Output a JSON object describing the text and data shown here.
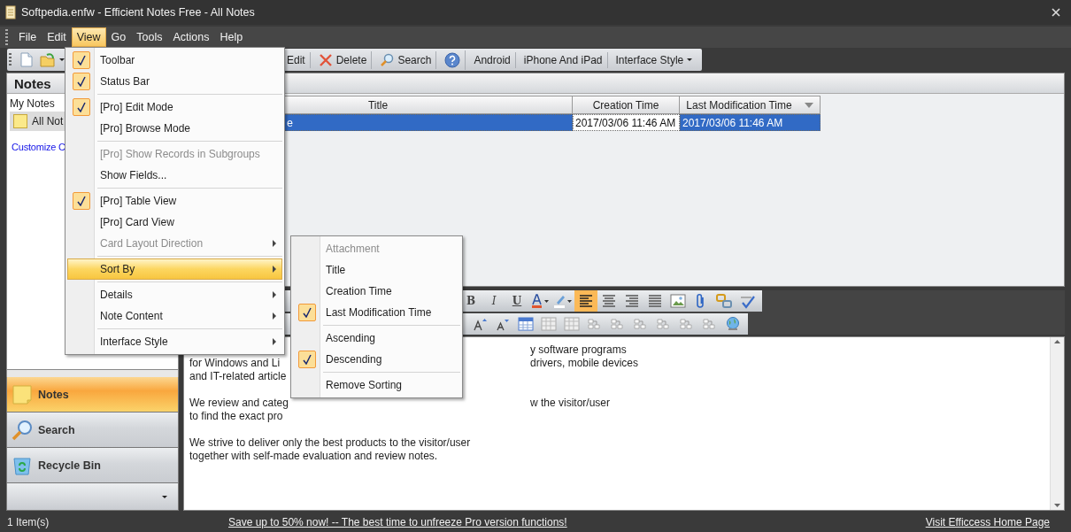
{
  "window": {
    "title": "Softpedia.enfw - Efficient Notes Free - All Notes"
  },
  "menubar": [
    {
      "label": "File",
      "selected": false
    },
    {
      "label": "Edit",
      "selected": false
    },
    {
      "label": "View",
      "selected": true
    },
    {
      "label": "Go",
      "selected": false
    },
    {
      "label": "Tools",
      "selected": false
    },
    {
      "label": "Actions",
      "selected": false
    },
    {
      "label": "Help",
      "selected": false
    }
  ],
  "toolbar": {
    "left": [
      {
        "kind": "new-document"
      },
      {
        "kind": "open-folder"
      }
    ],
    "right": [
      {
        "kind": "text",
        "label": "Edit"
      },
      {
        "kind": "delete",
        "label": "Delete"
      },
      {
        "kind": "search",
        "label": "Search"
      },
      {
        "kind": "help"
      },
      {
        "kind": "text",
        "label": "Android"
      },
      {
        "kind": "text",
        "label": "iPhone And iPad"
      },
      {
        "kind": "dropdown",
        "label": "Interface Style"
      }
    ]
  },
  "sidebar": {
    "title": "Notes",
    "group": "My Notes",
    "items": [
      {
        "label": "All Not",
        "selected": true
      }
    ],
    "link": "Customize C",
    "nav": [
      {
        "kind": "notes",
        "label": "Notes",
        "selected": true
      },
      {
        "kind": "search",
        "label": "Search",
        "selected": false
      },
      {
        "kind": "recycle",
        "label": "Recycle Bin",
        "selected": false
      }
    ]
  },
  "table": {
    "columns": [
      {
        "label": "Title",
        "sorted": false
      },
      {
        "label": "Creation Time",
        "sorted": false
      },
      {
        "label": "Last Modification Time",
        "sorted": true
      }
    ],
    "rows": [
      {
        "selected": true,
        "cells": [
          "e",
          "2017/03/06 11:46 AM",
          "2017/03/06 11:46 AM"
        ]
      }
    ]
  },
  "format_toolbar": {
    "row_1": [
      {
        "kind": "bold",
        "label": "B",
        "selected": false
      },
      {
        "kind": "italic",
        "label": "I",
        "selected": false
      },
      {
        "kind": "underline",
        "label": "U",
        "selected": false
      },
      {
        "kind": "font-color",
        "selected": false
      },
      {
        "kind": "highlight",
        "selected": false
      },
      {
        "kind": "align-left",
        "selected": true
      },
      {
        "kind": "align-center",
        "selected": false
      },
      {
        "kind": "align-right",
        "selected": false
      },
      {
        "kind": "justify",
        "selected": false
      },
      {
        "kind": "image",
        "selected": false
      },
      {
        "kind": "paperclip",
        "selected": false
      },
      {
        "kind": "chain",
        "selected": false
      },
      {
        "kind": "spellcheck",
        "selected": false
      }
    ],
    "row_2": [
      {
        "kind": "grow-font",
        "selected": false
      },
      {
        "kind": "shrink-font",
        "selected": false
      },
      {
        "kind": "table",
        "selected": false
      },
      {
        "kind": "table-grid",
        "selected": false
      },
      {
        "kind": "table-grid",
        "selected": false
      },
      {
        "kind": "table-op",
        "selected": false
      },
      {
        "kind": "table-op",
        "selected": false
      },
      {
        "kind": "table-op",
        "selected": false
      },
      {
        "kind": "table-op",
        "selected": false
      },
      {
        "kind": "table-op",
        "selected": false
      },
      {
        "kind": "table-op",
        "selected": false
      },
      {
        "kind": "globe",
        "selected": false
      }
    ]
  },
  "editor": {
    "paragraphs": [
      {
        "lines": [
          {
            "right": "y software programs"
          },
          {
            "left": "for Windows and Li",
            "right": "drivers, mobile devices"
          },
          {
            "left": "and IT-related article"
          }
        ]
      },
      {
        "lines": [
          {
            "left": "We review and categ",
            "right": "w the visitor/user"
          },
          {
            "left": "to find the exact pro"
          }
        ]
      },
      {
        "lines": [
          {
            "text": "We strive to deliver only the best products to the visitor/user"
          },
          {
            "text": "together with self-made evaluation and review notes."
          }
        ]
      }
    ]
  },
  "view_menu": [
    {
      "kind": "item",
      "label": "Toolbar",
      "checked": true,
      "disabled": false,
      "submenu": false,
      "selected": false
    },
    {
      "kind": "item",
      "label": "Status Bar",
      "checked": true,
      "disabled": false,
      "submenu": false,
      "selected": false
    },
    {
      "kind": "separator"
    },
    {
      "kind": "item",
      "label": "[Pro] Edit Mode",
      "checked": true,
      "disabled": false,
      "submenu": false,
      "selected": false
    },
    {
      "kind": "item",
      "label": "[Pro] Browse Mode",
      "checked": false,
      "disabled": false,
      "submenu": false,
      "selected": false
    },
    {
      "kind": "separator"
    },
    {
      "kind": "item",
      "label": "[Pro] Show Records in Subgroups",
      "checked": false,
      "disabled": true,
      "submenu": false,
      "selected": false
    },
    {
      "kind": "item",
      "label": "Show Fields...",
      "checked": false,
      "disabled": false,
      "submenu": false,
      "selected": false
    },
    {
      "kind": "separator"
    },
    {
      "kind": "item",
      "label": "[Pro] Table View",
      "checked": true,
      "disabled": false,
      "submenu": false,
      "selected": false
    },
    {
      "kind": "item",
      "label": "[Pro] Card View",
      "checked": false,
      "disabled": false,
      "submenu": false,
      "selected": false
    },
    {
      "kind": "item",
      "label": "Card Layout Direction",
      "checked": false,
      "disabled": true,
      "submenu": true,
      "selected": false
    },
    {
      "kind": "separator"
    },
    {
      "kind": "item",
      "label": "Sort By",
      "checked": false,
      "disabled": false,
      "submenu": true,
      "selected": true
    },
    {
      "kind": "separator"
    },
    {
      "kind": "item",
      "label": "Details",
      "checked": false,
      "disabled": false,
      "submenu": true,
      "selected": false
    },
    {
      "kind": "item",
      "label": "Note Content",
      "checked": false,
      "disabled": false,
      "submenu": true,
      "selected": false
    },
    {
      "kind": "separator"
    },
    {
      "kind": "item",
      "label": "Interface Style",
      "checked": false,
      "disabled": false,
      "submenu": true,
      "selected": false
    }
  ],
  "sort_menu": [
    {
      "kind": "item",
      "label": "Attachment",
      "checked": false,
      "disabled": true,
      "submenu": false,
      "selected": false
    },
    {
      "kind": "item",
      "label": "Title",
      "checked": false,
      "disabled": false,
      "submenu": false,
      "selected": false
    },
    {
      "kind": "item",
      "label": "Creation Time",
      "checked": false,
      "disabled": false,
      "submenu": false,
      "selected": false
    },
    {
      "kind": "item",
      "label": "Last Modification Time",
      "checked": true,
      "disabled": false,
      "submenu": false,
      "selected": false
    },
    {
      "kind": "separator"
    },
    {
      "kind": "item",
      "label": "Ascending",
      "checked": false,
      "disabled": false,
      "submenu": false,
      "selected": false
    },
    {
      "kind": "item",
      "label": "Descending",
      "checked": true,
      "disabled": false,
      "submenu": false,
      "selected": false
    },
    {
      "kind": "separator"
    },
    {
      "kind": "item",
      "label": "Remove Sorting",
      "checked": false,
      "disabled": false,
      "submenu": false,
      "selected": false
    }
  ],
  "status_bar": {
    "count": "1 Item(s)",
    "promo": "Save up to 50% now! -- The best time to unfreeze Pro version functions!",
    "link": "Visit Efficcess Home Page"
  }
}
